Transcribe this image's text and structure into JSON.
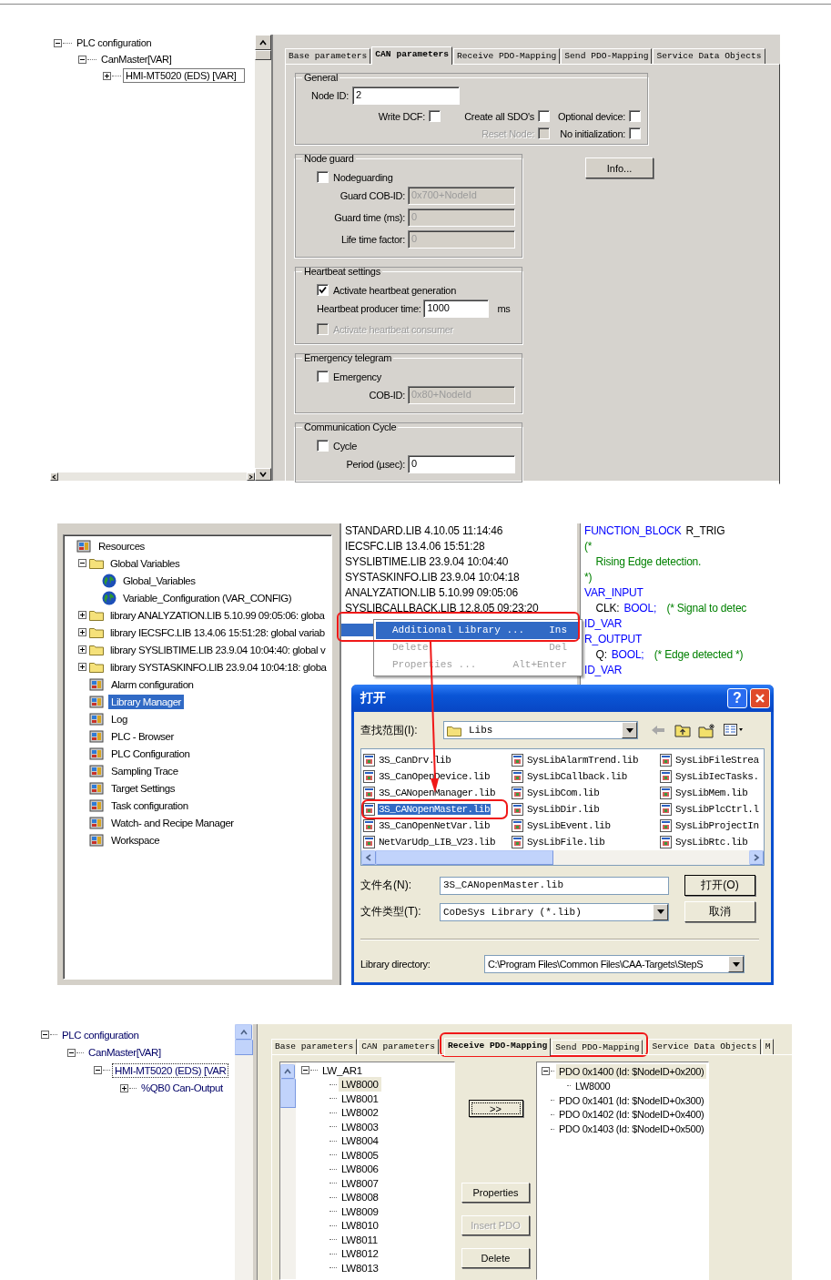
{
  "can_parameters_view": {
    "tree": [
      {
        "label": "PLC configuration",
        "expanded": true,
        "selected": false,
        "children": [
          {
            "label": "CanMaster[VAR]",
            "expanded": true,
            "selected": false,
            "children": [
              {
                "label": "HMI-MT5020 (EDS)  [VAR]",
                "expanded": false,
                "selected": true
              }
            ]
          }
        ]
      }
    ],
    "tabs": [
      {
        "label": "Base parameters",
        "selected": false,
        "highlighted": false
      },
      {
        "label": "CAN parameters",
        "selected": true,
        "highlighted": false
      },
      {
        "label": "Receive PDO-Mapping",
        "selected": false,
        "highlighted": false
      },
      {
        "label": "Send PDO-Mapping",
        "selected": false,
        "highlighted": false
      },
      {
        "label": "Service Data Objects",
        "selected": false,
        "highlighted": false
      }
    ],
    "general": {
      "title": "General",
      "node_id": {
        "label": "Node ID:",
        "value": "2"
      },
      "option_rows": [
        [
          {
            "label": "Write DCF:",
            "checked": false,
            "disabled": false
          },
          {
            "label": "Create all SDO's",
            "checked": false,
            "disabled": false
          },
          {
            "label": "Optional device:",
            "checked": false,
            "disabled": false
          }
        ],
        [
          {
            "label": "Reset Node:",
            "checked": false,
            "disabled": true
          },
          {
            "label": "No initialization:",
            "checked": false,
            "disabled": false
          }
        ]
      ]
    },
    "groups": [
      {
        "title": "Node guard",
        "fields": [
          {
            "kind": "checkbox",
            "label": "Nodeguarding",
            "checked": false,
            "disabled": false
          },
          {
            "kind": "input",
            "label": "Guard COB-ID:",
            "value": "0x700+NodeId",
            "disabled": true
          },
          {
            "kind": "input",
            "label": "Guard time (ms):",
            "value": "0",
            "disabled": true
          },
          {
            "kind": "input",
            "label": "Life time factor:",
            "value": "0",
            "disabled": true
          }
        ]
      },
      {
        "title": "Heartbeat settings",
        "fields": [
          {
            "kind": "checkbox",
            "label": "Activate heartbeat generation",
            "checked": true,
            "disabled": false
          },
          {
            "kind": "input",
            "label": "Heartbeat producer time:",
            "value": "1000",
            "disabled": false,
            "unit": "ms"
          },
          {
            "kind": "checkbox",
            "label": "Activate heartbeat consumer",
            "checked": false,
            "disabled": true
          }
        ]
      },
      {
        "title": "Emergency telegram",
        "fields": [
          {
            "kind": "checkbox",
            "label": "Emergency",
            "checked": false,
            "disabled": false
          },
          {
            "kind": "input",
            "label": "COB-ID:",
            "value": "0x80+NodeId",
            "disabled": true
          }
        ]
      },
      {
        "title": "Communication Cycle",
        "fields": [
          {
            "kind": "checkbox",
            "label": "Cycle",
            "checked": false,
            "disabled": false
          },
          {
            "kind": "input",
            "label": "Period (µsec):",
            "value": "0",
            "disabled": false
          }
        ]
      }
    ],
    "info_button": "Info..."
  },
  "library_manager_view": {
    "tree": [
      {
        "label": "Resources",
        "kind": "tool",
        "selected": false,
        "children": [
          {
            "label": "Global Variables",
            "kind": "folder",
            "expanded": true,
            "selected": false,
            "children": [
              {
                "label": "Global_Variables",
                "kind": "globe",
                "selected": false
              },
              {
                "label": "Variable_Configuration (VAR_CONFIG)",
                "kind": "globe",
                "selected": false
              }
            ]
          },
          {
            "label": "library ANALYZATION.LIB 5.10.99 09:05:06: globa",
            "kind": "folder",
            "expanded": false,
            "selected": false
          },
          {
            "label": "library IECSFC.LIB 13.4.06 15:51:28: global variab",
            "kind": "folder",
            "expanded": false,
            "selected": false
          },
          {
            "label": "library SYSLIBTIME.LIB 23.9.04 10:04:40: global v",
            "kind": "folder",
            "expanded": false,
            "selected": false
          },
          {
            "label": "library SYSTASKINFO.LIB 23.9.04 10:04:18: globa",
            "kind": "folder",
            "expanded": false,
            "selected": false
          },
          {
            "label": "Alarm configuration",
            "kind": "tool",
            "selected": false
          },
          {
            "label": "Library Manager",
            "kind": "tool",
            "selected": true
          },
          {
            "label": "Log",
            "kind": "tool",
            "selected": false
          },
          {
            "label": "PLC - Browser",
            "kind": "tool",
            "selected": false
          },
          {
            "label": "PLC Configuration",
            "kind": "tool",
            "selected": false
          },
          {
            "label": "Sampling Trace",
            "kind": "tool",
            "selected": false
          },
          {
            "label": "Target Settings",
            "kind": "tool",
            "selected": false
          },
          {
            "label": "Task configuration",
            "kind": "tool",
            "selected": false
          },
          {
            "label": "Watch- and Recipe Manager",
            "kind": "tool",
            "selected": false
          },
          {
            "label": "Workspace",
            "kind": "tool",
            "selected": false
          }
        ]
      }
    ],
    "libraries": [
      "STANDARD.LIB 4.10.05 11:14:46",
      "IECSFC.LIB 13.4.06 15:51:28",
      "SYSLIBTIME.LIB 23.9.04 10:04:40",
      "SYSTASKINFO.LIB 23.9.04 10:04:18",
      "ANALYZATION.LIB 5.10.99 09:05:06",
      "SYSLIBCALLBACK.LIB 12.8.05 09:23:20"
    ],
    "blank_row_selected": true,
    "code": [
      [
        {
          "kind": "keyword",
          "text": "FUNCTION_BLOCK"
        },
        {
          "kind": "ident",
          "text": "R_TRIG"
        }
      ],
      [
        {
          "kind": "comment",
          "text": "(*"
        }
      ],
      [
        {
          "kind": "comment",
          "text": "    Rising Edge detection."
        }
      ],
      [
        {
          "kind": "comment",
          "text": "*)"
        }
      ],
      [
        {
          "kind": "keyword",
          "text": "VAR_INPUT"
        }
      ],
      [
        {
          "kind": "ident",
          "text": "    CLK:"
        },
        {
          "kind": "keyword",
          "text": "BOOL;"
        },
        {
          "kind": "comment",
          "text": "  (* Signal to detec"
        }
      ],
      [
        {
          "kind": "keyword",
          "text": "ID_VAR"
        }
      ],
      [
        {
          "kind": "keyword",
          "text": "R_OUTPUT"
        }
      ],
      [
        {
          "kind": "ident",
          "text": "    Q:"
        },
        {
          "kind": "keyword",
          "text": "BOOL;"
        },
        {
          "kind": "comment",
          "text": "  (* Edge detected *)"
        }
      ],
      [
        {
          "kind": "keyword",
          "text": "ID_VAR"
        }
      ]
    ],
    "context_menu": [
      {
        "label": "Additional Library ...",
        "shortcut": "Ins",
        "selected": true,
        "disabled": false
      },
      {
        "label": "Delete",
        "shortcut": "Del",
        "selected": false,
        "disabled": true
      },
      {
        "label": "Properties ...",
        "shortcut": "Alt+Enter",
        "selected": false,
        "disabled": true
      }
    ],
    "open_dialog": {
      "title": "打开",
      "help_button": "?",
      "look_in_label": "查找范围(I):",
      "look_in": "Libs",
      "files": [
        {
          "name": "3S_CanDrv.lib",
          "selected": false
        },
        {
          "name": "3S_CanOpenDevice.lib",
          "selected": false
        },
        {
          "name": "3S_CANopenManager.lib",
          "selected": false
        },
        {
          "name": "3S_CANopenMaster.lib",
          "selected": true,
          "highlighted": true
        },
        {
          "name": "3S_CanOpenNetVar.lib",
          "selected": false
        },
        {
          "name": "NetVarUdp_LIB_V23.lib",
          "selected": false
        },
        {
          "name": "SysLibAlarmTrend.lib",
          "selected": false
        },
        {
          "name": "SysLibCallback.lib",
          "selected": false
        },
        {
          "name": "SysLibCom.lib",
          "selected": false
        },
        {
          "name": "SysLibDir.lib",
          "selected": false
        },
        {
          "name": "SysLibEvent.lib",
          "selected": false
        },
        {
          "name": "SysLibFile.lib",
          "selected": false
        },
        {
          "name": "SysLibFileStrea",
          "selected": false
        },
        {
          "name": "SysLibIecTasks.",
          "selected": false
        },
        {
          "name": "SysLibMem.lib",
          "selected": false
        },
        {
          "name": "SysLibPlcCtrl.l",
          "selected": false
        },
        {
          "name": "SysLibProjectIn",
          "selected": false
        },
        {
          "name": "SysLibRtc.lib",
          "selected": false
        }
      ],
      "file_name_label": "文件名(N):",
      "file_name": "3S_CANopenMaster.lib",
      "file_type_label": "文件类型(T):",
      "file_type": "CoDeSys Library (*.lib)",
      "open_button": "打开(O)",
      "cancel_button": "取消",
      "library_directory_label": "Library directory:",
      "library_directory": "C:\\Program Files\\Common Files\\CAA-Targets\\StepS"
    }
  },
  "pdo_mapping_view": {
    "tree": [
      {
        "label": "PLC configuration",
        "expanded": true,
        "selected": false,
        "children": [
          {
            "label": "CanMaster[VAR]",
            "expanded": true,
            "selected": false,
            "children": [
              {
                "label": "HMI-MT5020 (EDS)  [VAR",
                "expanded": true,
                "selected": true,
                "children": [
                  {
                    "label": "%QB0 Can-Output",
                    "expanded": false,
                    "selected": false
                  }
                ]
              }
            ]
          }
        ]
      }
    ],
    "tabs": [
      {
        "label": "Base parameters",
        "selected": false,
        "highlighted": false
      },
      {
        "label": "CAN parameters",
        "selected": false,
        "highlighted": false
      },
      {
        "label": "Receive PDO-Mapping",
        "selected": true,
        "highlighted": true
      },
      {
        "label": "Send PDO-Mapping",
        "selected": false,
        "highlighted": true
      },
      {
        "label": "Service Data Objects",
        "selected": false,
        "highlighted": false
      },
      {
        "label": "M",
        "selected": false,
        "highlighted": false
      }
    ],
    "objects": [
      {
        "label": "LW_AR1",
        "expanded": true,
        "selected": false,
        "children": [
          {
            "label": "LW8000",
            "selected": true
          },
          {
            "label": "LW8001",
            "selected": false
          },
          {
            "label": "LW8002",
            "selected": false
          },
          {
            "label": "LW8003",
            "selected": false
          },
          {
            "label": "LW8004",
            "selected": false
          },
          {
            "label": "LW8005",
            "selected": false
          },
          {
            "label": "LW8006",
            "selected": false
          },
          {
            "label": "LW8007",
            "selected": false
          },
          {
            "label": "LW8008",
            "selected": false
          },
          {
            "label": "LW8009",
            "selected": false
          },
          {
            "label": "LW8010",
            "selected": false
          },
          {
            "label": "LW8011",
            "selected": false
          },
          {
            "label": "LW8012",
            "selected": false
          },
          {
            "label": "LW8013",
            "selected": false
          }
        ]
      }
    ],
    "buttons": [
      {
        "label": ">>",
        "kind": "add",
        "disabled": false
      },
      {
        "label": "Properties",
        "kind": "action",
        "disabled": false
      },
      {
        "label": "Insert PDO",
        "kind": "action",
        "disabled": true
      },
      {
        "label": "Delete",
        "kind": "action",
        "disabled": false
      }
    ],
    "pdos": [
      {
        "label": "PDO 0x1400 (Id: $NodeID+0x200)",
        "expanded": true,
        "selected": true,
        "children": [
          {
            "label": "LW8000",
            "selected": false
          }
        ]
      },
      {
        "label": "PDO 0x1401 (Id: $NodeID+0x300)",
        "selected": false
      },
      {
        "label": "PDO 0x1402 (Id: $NodeID+0x400)",
        "selected": false
      },
      {
        "label": "PDO 0x1403 (Id: $NodeID+0x500)",
        "selected": false
      }
    ]
  }
}
